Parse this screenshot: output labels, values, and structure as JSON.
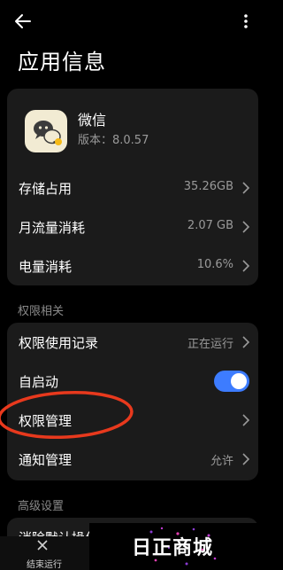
{
  "header": {
    "title": "应用信息"
  },
  "app": {
    "name": "微信",
    "version": "版本：8.0.57"
  },
  "main_rows": [
    {
      "label": "存储占用",
      "value": "35.26GB"
    },
    {
      "label": "月流量消耗",
      "value": "2.07 GB"
    },
    {
      "label": "电量消耗",
      "value": "10.6%"
    }
  ],
  "sections": {
    "permissions": "权限相关",
    "advanced": "高级设置"
  },
  "perm_rows": [
    {
      "label": "权限使用记录",
      "value": "正在运行"
    },
    {
      "label": "自启动",
      "toggle_on": true
    },
    {
      "label": "权限管理",
      "value": ""
    },
    {
      "label": "通知管理",
      "value": "允许"
    }
  ],
  "advanced_rows": [
    {
      "label": "消除默认操作"
    }
  ],
  "bottom_bar": {
    "stop_label": "结束运行"
  },
  "watermark": {
    "text": "日正商城"
  },
  "colors": {
    "accent": "#3d7cff",
    "highlight": "#e8391d",
    "card": "#1b1b1b"
  }
}
